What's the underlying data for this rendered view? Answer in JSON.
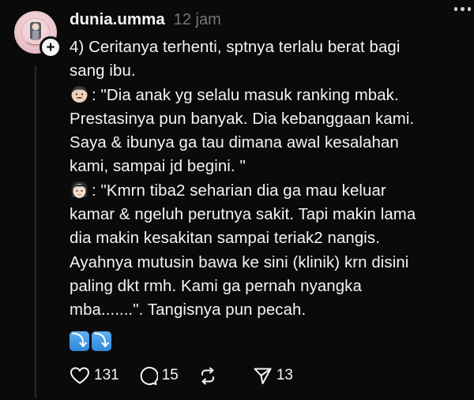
{
  "post": {
    "username": "dunia.umma",
    "timestamp": "12 jam",
    "lines": [
      "4) Ceritanya terhenti, sptnya terlalu berat bagi sang ibu.",
      ": \"Dia anak yg selalu masuk ranking mbak. Prestasinya pun banyak. Dia kebanggaan kami. Saya & ibunya ga tau dimana awal kesalahan kami, sampai jd begini. \"",
      ": \"Kmrn tiba2 seharian dia ga mau keluar kamar & ngeluh perutnya sakit. Tapi makin lama dia makin kesakitan sampai teriak2 nangis. Ayahnya mutusin bawa ke sini (klinik) krn disini paling dkt rmh. Kami ga pernah nyangka mba.......\". Tangisnya pun pecah."
    ],
    "line1a": "4) Ceritanya terhenti, sptnya terlalu berat bagi",
    "line1b": "sang ibu.",
    "father_quote": {
      "icon": "man-face-emoji",
      "l1": ": \"Dia anak yg selalu masuk ranking mbak.",
      "l2": "Prestasinya pun banyak. Dia kebanggaan kami.",
      "l3": "Saya & ibunya ga tau dimana awal kesalahan",
      "l4": "kami, sampai jd begini. \""
    },
    "mother_quote": {
      "icon": "woman-face-emoji",
      "l1": ": \"Kmrn tiba2 seharian dia ga mau keluar",
      "l2": "kamar & ngeluh perutnya sakit. Tapi makin lama",
      "l3": "dia makin kesakitan sampai teriak2 nangis.",
      "l4": "Ayahnya mutusin bawa ke sini (klinik) krn disini",
      "l5": "paling dkt rmh. Kami ga pernah nyangka",
      "l6": "mba.......\". Tangisnya pun pecah."
    },
    "arrows": [
      "⤵",
      "⤵"
    ]
  },
  "actions": {
    "likes": "131",
    "replies": "15",
    "shares": "13"
  },
  "icons": {
    "like": "heart-icon",
    "reply": "comment-icon",
    "repost": "repost-icon",
    "share": "send-icon",
    "more": "more-dots-icon"
  },
  "colors": {
    "background": "#0a0a0a",
    "text": "#f3f5f7",
    "muted": "#777777",
    "arrow_emoji": "#3b8fe0"
  }
}
